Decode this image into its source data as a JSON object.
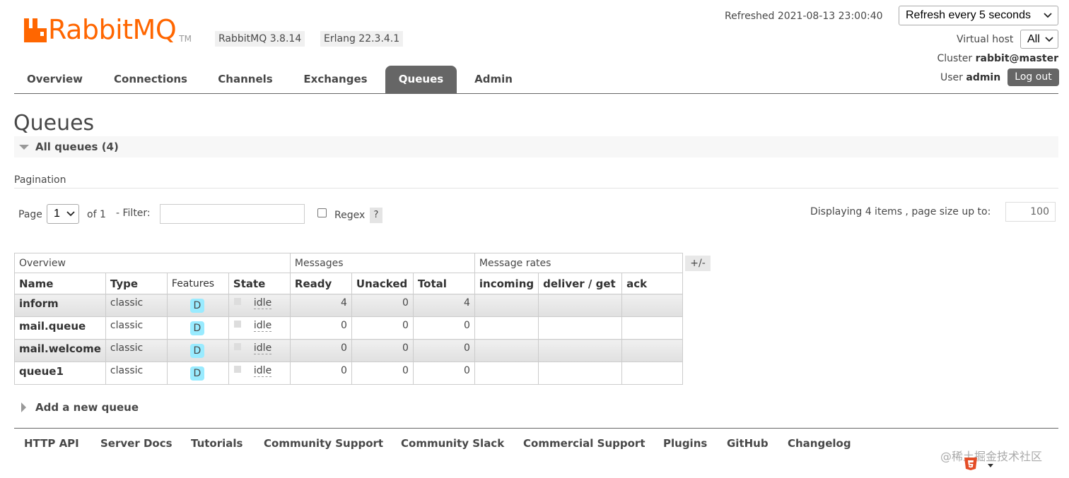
{
  "header": {
    "logo_text": "RabbitMQ",
    "logo_tm": "TM",
    "rabbit_version": "RabbitMQ 3.8.14",
    "erlang_version": "Erlang 22.3.4.1",
    "refreshed": "Refreshed 2021-08-13 23:00:40",
    "refresh_option": "Refresh every 5 seconds",
    "virtual_host_label": "Virtual host",
    "virtual_host_value": "All",
    "cluster_label": "Cluster",
    "cluster_name": "rabbit@master",
    "user_label": "User",
    "user_name": "admin",
    "logout_label": "Log out"
  },
  "tabs": [
    {
      "label": "Overview"
    },
    {
      "label": "Connections"
    },
    {
      "label": "Channels"
    },
    {
      "label": "Exchanges"
    },
    {
      "label": "Queues"
    },
    {
      "label": "Admin"
    }
  ],
  "page": {
    "title": "Queues",
    "section_title": "All queues (4)",
    "pagination_heading": "Pagination",
    "page_label": "Page",
    "page_value": "1",
    "of_label": "of 1",
    "filter_label": "- Filter:",
    "filter_value": "",
    "regex_label": "Regex",
    "help_label": "?",
    "displaying": "Displaying 4 items , page size up to:",
    "page_size": "100",
    "columns_toggle": "+/-",
    "add_queue": "Add a new queue"
  },
  "table": {
    "groups": [
      "Overview",
      "Messages",
      "Message rates"
    ],
    "columns": [
      "Name",
      "Type",
      "Features",
      "State",
      "Ready",
      "Unacked",
      "Total",
      "incoming",
      "deliver / get",
      "ack"
    ],
    "rows": [
      {
        "name": "inform",
        "type": "classic",
        "feature": "D",
        "state": "idle",
        "ready": "4",
        "unacked": "0",
        "total": "4",
        "incoming": "",
        "deliver": "",
        "ack": ""
      },
      {
        "name": "mail.queue",
        "type": "classic",
        "feature": "D",
        "state": "idle",
        "ready": "0",
        "unacked": "0",
        "total": "0",
        "incoming": "",
        "deliver": "",
        "ack": ""
      },
      {
        "name": "mail.welcome",
        "type": "classic",
        "feature": "D",
        "state": "idle",
        "ready": "0",
        "unacked": "0",
        "total": "0",
        "incoming": "",
        "deliver": "",
        "ack": ""
      },
      {
        "name": "queue1",
        "type": "classic",
        "feature": "D",
        "state": "idle",
        "ready": "0",
        "unacked": "0",
        "total": "0",
        "incoming": "",
        "deliver": "",
        "ack": ""
      }
    ]
  },
  "footer": {
    "links": [
      "HTTP API",
      "Server Docs",
      "Tutorials",
      "Community Support",
      "Community Slack",
      "Commercial Support",
      "Plugins",
      "GitHub",
      "Changelog"
    ],
    "watermark": "@稀土掘金技术社区"
  },
  "colors": {
    "brand": "#ff6600",
    "active_tab": "#666666",
    "durable_badge": "#99ebff"
  }
}
